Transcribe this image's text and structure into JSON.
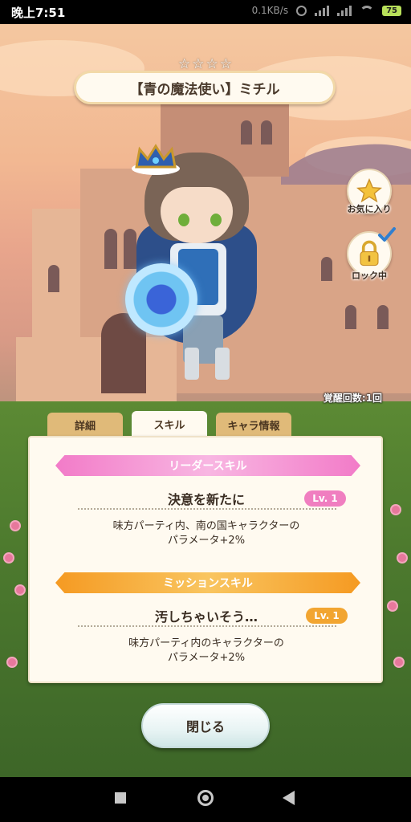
{
  "status_bar": {
    "time": "晚上7:51",
    "network_speed": "0.1KB/s",
    "battery": "75"
  },
  "character": {
    "title": "【青の魔法使い】ミチル",
    "stars": [
      "☆",
      "☆",
      "☆",
      "☆"
    ]
  },
  "side_buttons": {
    "favorite_label": "お気に入り",
    "lock_label": "ロック中"
  },
  "awakening": "覚醒回数:1回",
  "tabs": [
    {
      "label": "詳細",
      "active": false
    },
    {
      "label": "スキル",
      "active": true
    },
    {
      "label": "キャラ情報",
      "active": false
    }
  ],
  "skills": {
    "leader": {
      "header": "リーダースキル",
      "name": "決意を新たに",
      "level": "Lv. 1",
      "desc_line1": "味方パーティ内、南の国キャラクターの",
      "desc_line2": "パラメータ+2%"
    },
    "mission": {
      "header": "ミッションスキル",
      "name": "汚しちゃいそう…",
      "level": "Lv. 1",
      "desc_line1": "味方パーティ内のキャラクターの",
      "desc_line2": "パラメータ+2%"
    }
  },
  "close_button": "閉じる",
  "colors": {
    "leader_accent": "#f27bc8",
    "mission_accent": "#f59a22",
    "tab_inactive": "#e0ba79",
    "panel_bg": "#fffaf0"
  },
  "icons": {
    "favorite": "star-icon",
    "lock": "lock-icon",
    "locked_check": "check-icon",
    "nav": [
      "recent-apps-icon",
      "home-icon",
      "back-icon"
    ]
  }
}
